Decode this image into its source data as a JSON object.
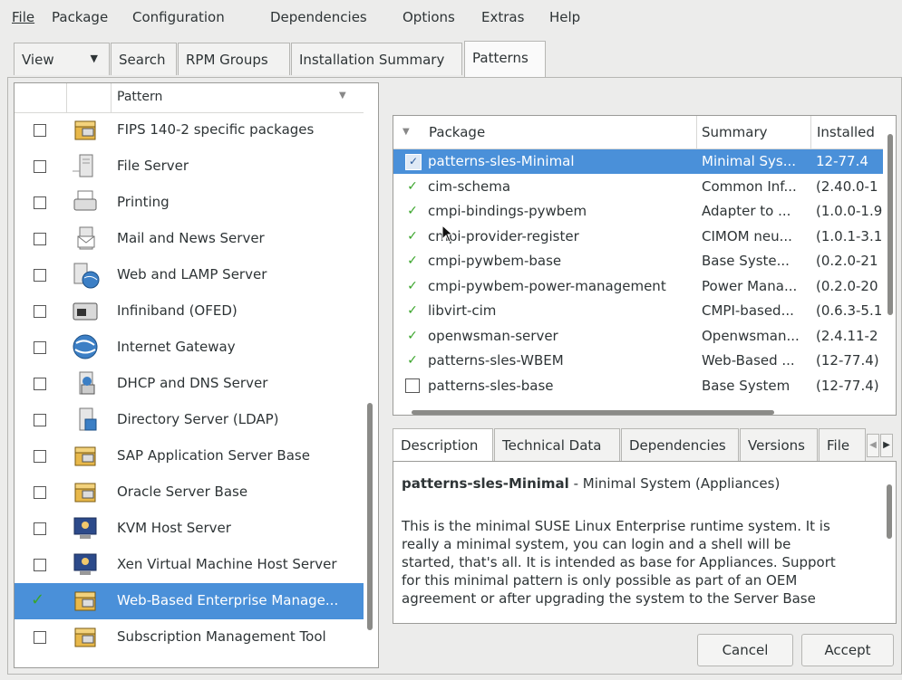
{
  "menubar": {
    "items": [
      {
        "label": "File"
      },
      {
        "label": "Package"
      },
      {
        "label": "Configuration"
      },
      {
        "label": "Dependencies"
      },
      {
        "label": "Options"
      },
      {
        "label": "Extras"
      },
      {
        "label": "Help"
      }
    ]
  },
  "tabs": {
    "view_label": "View",
    "items": [
      {
        "label": "Search"
      },
      {
        "label": "RPM Groups"
      },
      {
        "label": "Installation Summary"
      },
      {
        "label": "Patterns"
      }
    ],
    "active": "Patterns"
  },
  "patterns": {
    "column_header": "Pattern",
    "items": [
      {
        "name": "FIPS 140-2 specific packages",
        "icon": "package-icon",
        "checked": false
      },
      {
        "name": "File Server",
        "icon": "file-server-icon",
        "checked": false
      },
      {
        "name": "Printing",
        "icon": "printer-icon",
        "checked": false
      },
      {
        "name": "Mail and News Server",
        "icon": "mail-server-icon",
        "checked": false
      },
      {
        "name": "Web and LAMP Server",
        "icon": "web-server-icon",
        "checked": false
      },
      {
        "name": "Infiniband (OFED)",
        "icon": "network-icon",
        "checked": false
      },
      {
        "name": "Internet Gateway",
        "icon": "globe-icon",
        "checked": false
      },
      {
        "name": "DHCP and DNS Server",
        "icon": "dns-server-icon",
        "checked": false
      },
      {
        "name": "Directory Server (LDAP)",
        "icon": "directory-server-icon",
        "checked": false
      },
      {
        "name": "SAP Application Server Base",
        "icon": "package-icon",
        "checked": false
      },
      {
        "name": "Oracle Server Base",
        "icon": "package-icon",
        "checked": false
      },
      {
        "name": "KVM Host Server",
        "icon": "virtual-machine-icon",
        "checked": false
      },
      {
        "name": "Xen Virtual Machine Host Server",
        "icon": "virtual-machine-icon",
        "checked": false
      },
      {
        "name": "Web-Based Enterprise Manage...",
        "icon": "package-icon",
        "checked": true,
        "selected": true
      },
      {
        "name": "Subscription Management Tool",
        "icon": "package-icon",
        "checked": false
      }
    ]
  },
  "packages": {
    "headers": {
      "package": "Package",
      "summary": "Summary",
      "installed": "Installed"
    },
    "rows": [
      {
        "status": "installed-check",
        "name": "patterns-sles-Minimal",
        "summary": "Minimal Sys...",
        "installed": "12-77.4",
        "selected": true
      },
      {
        "status": "auto-install",
        "name": "cim-schema",
        "summary": "Common Inf...",
        "installed": "(2.40.0-1"
      },
      {
        "status": "auto-install",
        "name": "cmpi-bindings-pywbem",
        "summary": "Adapter to ...",
        "installed": "(1.0.0-1.9"
      },
      {
        "status": "auto-install",
        "name": "cmpi-provider-register",
        "summary": "CIMOM neu...",
        "installed": "(1.0.1-3.1"
      },
      {
        "status": "auto-install",
        "name": "cmpi-pywbem-base",
        "summary": "Base Syste...",
        "installed": "(0.2.0-21"
      },
      {
        "status": "auto-install",
        "name": "cmpi-pywbem-power-management",
        "summary": "Power Mana...",
        "installed": "(0.2.0-20"
      },
      {
        "status": "auto-install",
        "name": "libvirt-cim",
        "summary": "CMPI-based...",
        "installed": "(0.6.3-5.1"
      },
      {
        "status": "auto-install",
        "name": "openwsman-server",
        "summary": "Openwsman...",
        "installed": "(2.4.11-2"
      },
      {
        "status": "auto-install",
        "name": "patterns-sles-WBEM",
        "summary": "Web-Based ...",
        "installed": "(12-77.4)"
      },
      {
        "status": "not-installed",
        "name": "patterns-sles-base",
        "summary": "Base System",
        "installed": "(12-77.4)"
      }
    ]
  },
  "details": {
    "tabs": [
      {
        "label": "Description"
      },
      {
        "label": "Technical Data"
      },
      {
        "label": "Dependencies"
      },
      {
        "label": "Versions"
      },
      {
        "label": "File"
      }
    ],
    "title_bold": "patterns-sles-Minimal",
    "title_rest": " - Minimal System (Appliances)",
    "body_lines": [
      "This is the minimal SUSE Linux Enterprise runtime system. It is",
      "really a minimal system, you can login and a shell will be",
      "started, that's all. It is intended as base for Appliances. Support",
      "for this minimal pattern is only possible as part of an OEM",
      "agreement or after upgrading the system to the Server Base"
    ]
  },
  "buttons": {
    "cancel": "Cancel",
    "accept": "Accept"
  }
}
